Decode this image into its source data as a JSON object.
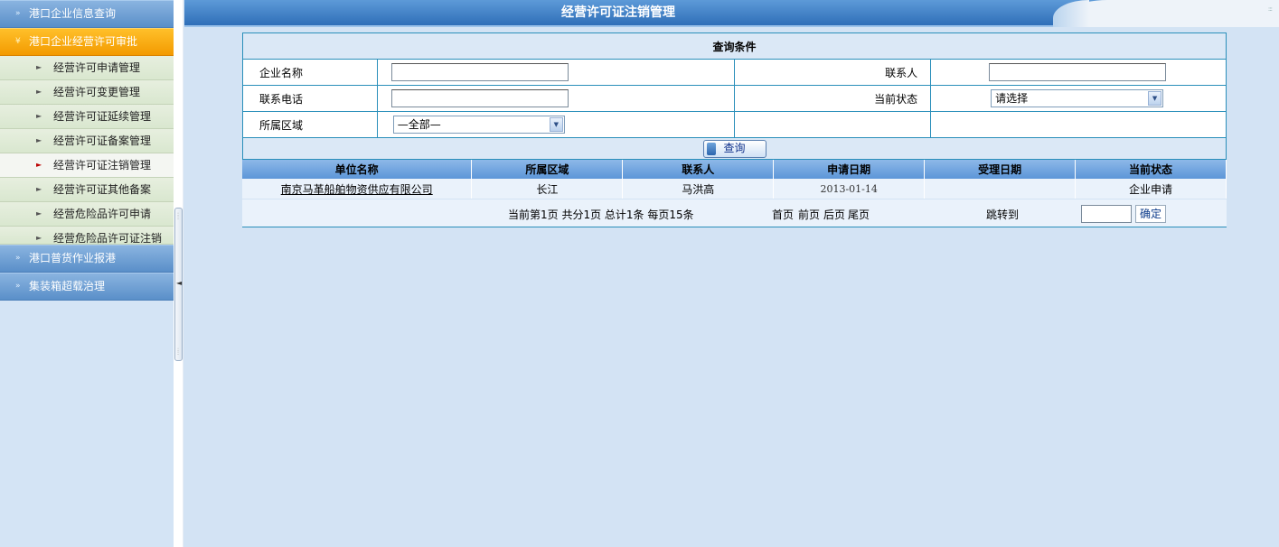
{
  "sidebar": {
    "groups": [
      {
        "label": "港口企业信息查询"
      },
      {
        "label": "港口企业经营许可审批"
      },
      {
        "label": "港口普货作业报港"
      },
      {
        "label": "集装箱超载治理"
      }
    ],
    "items": [
      {
        "label": "经营许可申请管理"
      },
      {
        "label": "经营许可变更管理"
      },
      {
        "label": "经营许可证延续管理"
      },
      {
        "label": "经营许可证备案管理"
      },
      {
        "label": "经营许可证注销管理"
      },
      {
        "label": "经营许可证其他备案"
      },
      {
        "label": "经营危险品许可申请"
      },
      {
        "label": "经营危险品许可证注销"
      }
    ],
    "selected": "经营许可证注销管理"
  },
  "page": {
    "title": "经营许可证注销管理"
  },
  "query": {
    "header": "查询条件",
    "company_label": "企业名称",
    "contact_label": "联系人",
    "phone_label": "联系电话",
    "status_label": "当前状态",
    "status_value": "请选择",
    "region_label": "所属区域",
    "region_value": "—全部—",
    "search_label": "查询"
  },
  "results": {
    "columns": [
      "单位名称",
      "所属区域",
      "联系人",
      "申请日期",
      "受理日期",
      "当前状态"
    ],
    "rows": [
      {
        "company": "南京马革船舶物资供应有限公司",
        "region": "长江",
        "contact": "马洪高",
        "apply_date": "2013-01-14",
        "accept_date": "",
        "status": "企业申请"
      }
    ]
  },
  "pager": {
    "summary": "当前第1页  共分1页  总计1条  每页15条",
    "first": "首页",
    "prev": "前页",
    "next": "后页",
    "last": "尾页",
    "jump_label": "跳转到",
    "confirm": "确定"
  }
}
